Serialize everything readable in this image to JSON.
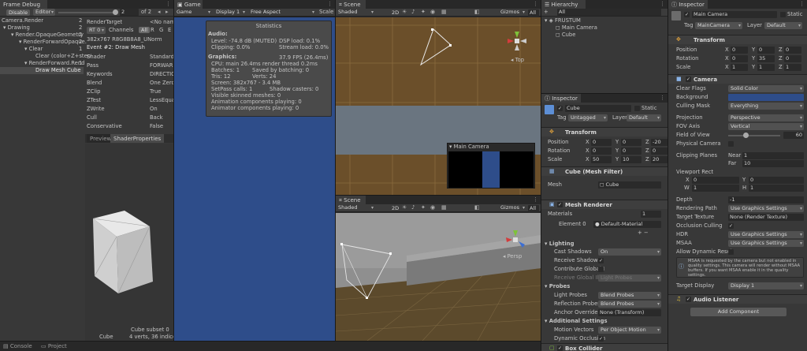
{
  "frame_debug": {
    "tab": "Frame Debug",
    "disable_btn": "Disable",
    "editor_dd": "Editor",
    "frame_num": "2",
    "frame_of": "of 2",
    "tree": [
      {
        "label": "Camera.Render",
        "count": "2"
      },
      {
        "label": "Drawing",
        "count": "2"
      },
      {
        "label": "Render.OpaqueGeometry",
        "count": "2"
      },
      {
        "label": "RenderForwardOpaque.",
        "count": "2"
      },
      {
        "label": "Clear",
        "count": "1"
      },
      {
        "label": "Clear (color+Z+sten",
        "count": ""
      },
      {
        "label": "RenderForward.Rend",
        "count": "1"
      },
      {
        "label": "Draw Mesh Cube",
        "count": ""
      }
    ],
    "rt_label": "RenderTarget",
    "rt_value": "<No name",
    "rt_dd": "RT 0",
    "channels_label": "Channels",
    "channels": [
      "All",
      "R",
      "G",
      "E"
    ],
    "format": "382x767 R8G8B8A8_UNorm",
    "event": "Event #2: Draw Mesh",
    "props": [
      {
        "k": "Shader",
        "v": "Standard,"
      },
      {
        "k": "Pass",
        "v": "FORWARD"
      },
      {
        "k": "Keywords",
        "v": "DIRECTIO"
      },
      {
        "k": "Blend",
        "v": "One Zero"
      },
      {
        "k": "ZClip",
        "v": "True"
      },
      {
        "k": "ZTest",
        "v": "LessEqua"
      },
      {
        "k": "ZWrite",
        "v": "On"
      },
      {
        "k": "Cull",
        "v": "Back"
      },
      {
        "k": "Conservative",
        "v": "False"
      }
    ],
    "preview_tab": "Preview",
    "shaderprops_tab": "ShaderProperties",
    "subset": "Cube subset 0",
    "mesh_name": "Cube",
    "mesh_info": "4 verts, 36 indices"
  },
  "game": {
    "tab": "Game",
    "game_dd": "Game",
    "display_dd": "Display 1",
    "aspect_dd": "Free Aspect",
    "scale": "Scale",
    "stats": {
      "title": "Statistics",
      "audio_h": "Audio:",
      "level": "Level: -74.8 dB (MUTED)",
      "dsp": "DSP load: 0.1%",
      "clipping": "Clipping: 0.0%",
      "stream": "Stream load: 0.0%",
      "graphics_h": "Graphics:",
      "fps": "37.9 FPS (26.4ms)",
      "cpu": "CPU: main 26.4ms  render thread 0.2ms",
      "batches": "Batches: 1",
      "saved": "Saved by batching: 0",
      "tris": "Tris: 12",
      "verts": "Verts: 24",
      "screen": "Screen: 382x767 - 3.4 MB",
      "setpass": "SetPass calls: 1",
      "shadow": "Shadow casters: 0",
      "skinned": "Visible skinned meshes: 0",
      "anim": "Animation components playing: 0",
      "animator": "Animator components playing: 0"
    }
  },
  "scene1": {
    "tab": "Scene",
    "shaded": "Shaded",
    "mode2d": "2D",
    "gizmos": "Gizmos",
    "search": "All",
    "persp": "Top",
    "main_camera_preview": "Main Camera"
  },
  "scene2": {
    "tab": "Scene",
    "shaded": "Shaded",
    "mode2d": "2D",
    "gizmos": "Gizmos",
    "search": "All",
    "persp": "Persp"
  },
  "hierarchy": {
    "tab": "Hierarchy",
    "plus": "+",
    "search": "All",
    "items": [
      {
        "label": "FRUSTUM",
        "indent": 0
      },
      {
        "label": "Main Camera",
        "indent": 1
      },
      {
        "label": "Cube",
        "indent": 1
      }
    ]
  },
  "inspector_small": {
    "tab": "Inspector",
    "name": "Cube",
    "static": "Static",
    "tag_label": "Tag",
    "tag": "Untagged",
    "layer_label": "Layer",
    "layer": "Default",
    "transform": {
      "title": "Transform",
      "rows": [
        {
          "label": "Position",
          "x": "0",
          "y": "0",
          "z": "-20"
        },
        {
          "label": "Rotation",
          "x": "0",
          "y": "0",
          "z": "0"
        },
        {
          "label": "Scale",
          "x": "50",
          "y": "10",
          "z": "20"
        }
      ]
    },
    "mesh_filter": {
      "title": "Cube (Mesh Filter)",
      "mesh_label": "Mesh",
      "mesh": "Cube"
    },
    "mesh_renderer": {
      "title": "Mesh Renderer",
      "materials": "Materials",
      "materials_count": "1",
      "element0": "Element 0",
      "material": "Default-Material",
      "lighting": "Lighting",
      "cast_shadows": "Cast Shadows",
      "cast_shadows_v": "On",
      "receive_shadows": "Receive Shadows",
      "contribute_gi": "Contribute Global I",
      "receive_gi": "Receive Global Illu",
      "receive_gi_v": "Light Probes",
      "probes": "Probes",
      "light_probes": "Light Probes",
      "light_probes_v": "Blend Probes",
      "reflection_probes": "Reflection Probes",
      "reflection_probes_v": "Blend Probes",
      "anchor": "Anchor Override",
      "anchor_v": "None (Transform)",
      "additional": "Additional Settings",
      "motion": "Motion Vectors",
      "motion_v": "Per Object Motion",
      "dynamic_occ": "Dynamic Occlusion"
    },
    "box_collider": "Box Collider"
  },
  "inspector_main": {
    "tab": "Inspector",
    "name": "Main Camera",
    "static": "Static",
    "tag_label": "Tag",
    "tag": "MainCamera",
    "layer_label": "Layer",
    "layer": "Default",
    "transform": {
      "title": "Transform",
      "rows": [
        {
          "label": "Position",
          "x": "0",
          "y": "0",
          "z": "0"
        },
        {
          "label": "Rotation",
          "x": "0",
          "y": "35",
          "z": "0"
        },
        {
          "label": "Scale",
          "x": "1",
          "y": "1",
          "z": "1"
        }
      ]
    },
    "camera": {
      "title": "Camera",
      "clear_flags": "Clear Flags",
      "clear_flags_v": "Solid Color",
      "background": "Background",
      "background_color": "#2e4d8a",
      "culling": "Culling Mask",
      "culling_v": "Everything",
      "projection": "Projection",
      "projection_v": "Perspective",
      "fov_axis": "FOV Axis",
      "fov_axis_v": "Vertical",
      "fov": "Field of View",
      "fov_v": "60",
      "fov_fraction": 0.33,
      "physical": "Physical Camera",
      "clipping": "Clipping Planes",
      "near": "Near",
      "near_v": "1",
      "far": "Far",
      "far_v": "10",
      "viewport": "Viewport Rect",
      "vx": "0",
      "vy": "0",
      "vw": "1",
      "vh": "1",
      "depth": "Depth",
      "depth_v": "-1",
      "rendering_path": "Rendering Path",
      "rendering_path_v": "Use Graphics Settings",
      "target_texture": "Target Texture",
      "target_texture_v": "None (Render Texture)",
      "occlusion": "Occlusion Culling",
      "hdr": "HDR",
      "hdr_v": "Use Graphics Settings",
      "msaa": "MSAA",
      "msaa_v": "Use Graphics Settings",
      "dynamic_res": "Allow Dynamic Resol",
      "info": "MSAA is requested by the camera but not enabled in quality settings. This camera will render without MSAA buffers. If you want MSAA enable it in the quality settings.",
      "target_display": "Target Display",
      "target_display_v": "Display 1"
    },
    "audio_listener": "Audio Listener",
    "add_component": "Add Component"
  },
  "bottom": {
    "console": "Console",
    "project": "Project"
  }
}
